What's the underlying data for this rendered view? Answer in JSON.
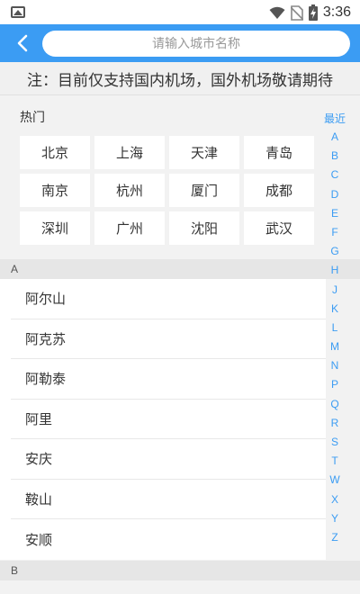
{
  "status_bar": {
    "time": "3:36",
    "icons": [
      "image-icon",
      "wifi-icon",
      "no-sim-icon",
      "battery-charging-icon"
    ]
  },
  "header": {
    "back_icon": "chevron-left-icon",
    "search_placeholder": "请输入城市名称"
  },
  "notice": "注：目前仅支持国内机场，国外机场敬请期待",
  "hot": {
    "title": "热门",
    "cities": [
      "北京",
      "上海",
      "天津",
      "青岛",
      "南京",
      "杭州",
      "厦门",
      "成都",
      "深圳",
      "广州",
      "沈阳",
      "武汉"
    ]
  },
  "groups": [
    {
      "letter": "A",
      "cities": [
        "阿尔山",
        "阿克苏",
        "阿勒泰",
        "阿里",
        "安庆",
        "鞍山",
        "安顺"
      ]
    },
    {
      "letter": "B",
      "cities": []
    }
  ],
  "index": [
    "最近",
    "A",
    "B",
    "C",
    "D",
    "E",
    "F",
    "G",
    "H",
    "J",
    "K",
    "L",
    "M",
    "N",
    "P",
    "Q",
    "R",
    "S",
    "T",
    "W",
    "X",
    "Y",
    "Z"
  ],
  "colors": {
    "accent": "#3b9cf3",
    "background": "#f2f2f2",
    "text": "#333333"
  }
}
